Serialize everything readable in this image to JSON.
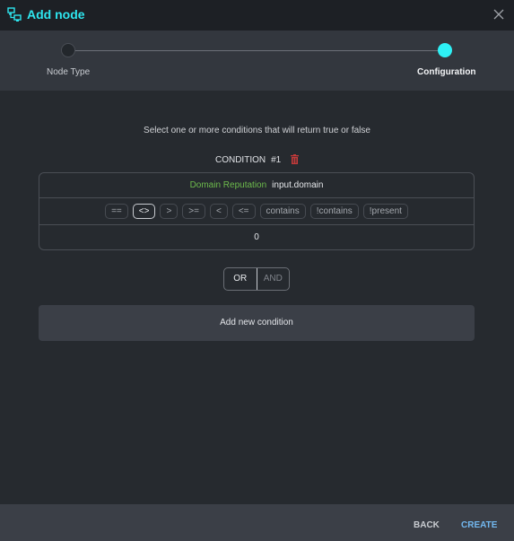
{
  "dialog": {
    "title": "Add node",
    "title_icon": "node-network-icon",
    "close_icon": "close-icon"
  },
  "stepper": {
    "steps": [
      {
        "label": "Node Type",
        "state": "completed"
      },
      {
        "label": "Configuration",
        "state": "active"
      }
    ],
    "active_color": "#2ef0f5"
  },
  "main": {
    "instructions": "Select one or more conditions that will return true or false",
    "condition": {
      "title": "CONDITION",
      "number": "#1",
      "delete_icon": "trash-icon",
      "field_name": "Domain Reputation",
      "field_path": "input.domain",
      "operators": [
        "==",
        "<>",
        ">",
        ">=",
        "<",
        "<=",
        "contains",
        "!contains",
        "!present"
      ],
      "selected_operator": "<>",
      "value": "0"
    },
    "logic": {
      "options": [
        "OR",
        "AND"
      ],
      "selected": "OR"
    },
    "add_condition_label": "Add new condition"
  },
  "footer": {
    "back_label": "BACK",
    "create_label": "CREATE"
  }
}
